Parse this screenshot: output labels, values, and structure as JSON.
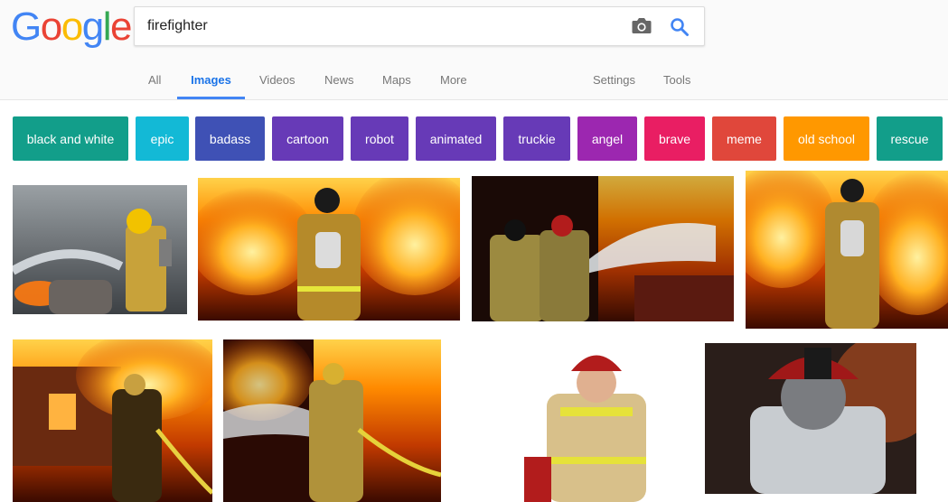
{
  "logo": {
    "letters": [
      "G",
      "o",
      "o",
      "g",
      "l",
      "e"
    ]
  },
  "search": {
    "query": "firefighter"
  },
  "nav": {
    "all": "All",
    "images": "Images",
    "videos": "Videos",
    "news": "News",
    "maps": "Maps",
    "more": "More",
    "settings": "Settings",
    "tools": "Tools"
  },
  "chips": [
    {
      "label": "black and white",
      "color": "#129e8a"
    },
    {
      "label": "epic",
      "color": "#13b9d6"
    },
    {
      "label": "badass",
      "color": "#3f51b5"
    },
    {
      "label": "cartoon",
      "color": "#673ab7"
    },
    {
      "label": "robot",
      "color": "#673ab7"
    },
    {
      "label": "animated",
      "color": "#673ab7"
    },
    {
      "label": "truckie",
      "color": "#673ab7"
    },
    {
      "label": "angel",
      "color": "#9c27b0"
    },
    {
      "label": "brave",
      "color": "#e91e63"
    },
    {
      "label": "meme",
      "color": "#e0473b"
    },
    {
      "label": "old school",
      "color": "#ff9800"
    },
    {
      "label": "rescue",
      "color": "#129e8a"
    }
  ],
  "colors": {
    "google_blue": "#4285f4",
    "google_red": "#ea4335",
    "google_yellow": "#fbbc05",
    "google_green": "#34a853",
    "active_tab": "#1a73e8",
    "inactive_tab": "#777777"
  },
  "icons": {
    "camera": "camera-icon",
    "search": "search-icon"
  }
}
